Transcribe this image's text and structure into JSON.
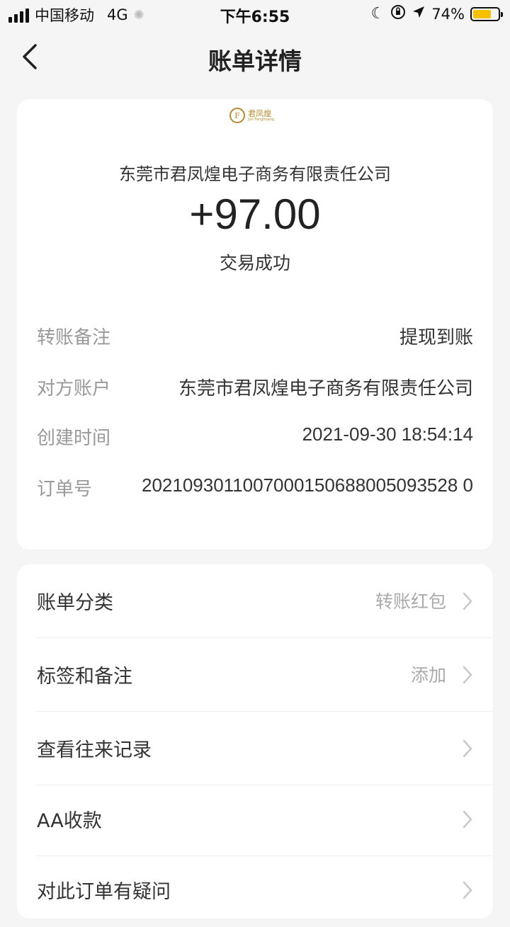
{
  "status_bar": {
    "carrier": "中国移动",
    "network": "4G",
    "time": "下午6:55",
    "battery_percent": "74%",
    "battery_level": 0.74,
    "battery_color": "#f4c000"
  },
  "nav": {
    "title": "账单详情",
    "back_icon": "chevron-left-icon"
  },
  "header": {
    "logo_text": "君凤煌",
    "logo_sub": "Jun Fenghuang",
    "logo_letter": "F",
    "merchant": "东莞市君凤煌电子商务有限责任公司",
    "amount": "+97.00",
    "status": "交易成功"
  },
  "details": [
    {
      "label": "转账备注",
      "value": "提现到账"
    },
    {
      "label": "对方账户",
      "value": "东莞市君凤煌电子商务有限责任公司"
    },
    {
      "label": "创建时间",
      "value": "2021-09-30 18:54:14"
    },
    {
      "label": "订单号",
      "value": "2021093011007000150688005093528 0"
    }
  ],
  "menu": [
    {
      "label": "账单分类",
      "value": "转账红包"
    },
    {
      "label": "标签和备注",
      "value": "添加"
    },
    {
      "label": "查看往来记录",
      "value": ""
    },
    {
      "label": "AA收款",
      "value": ""
    },
    {
      "label": "对此订单有疑问",
      "value": ""
    }
  ]
}
